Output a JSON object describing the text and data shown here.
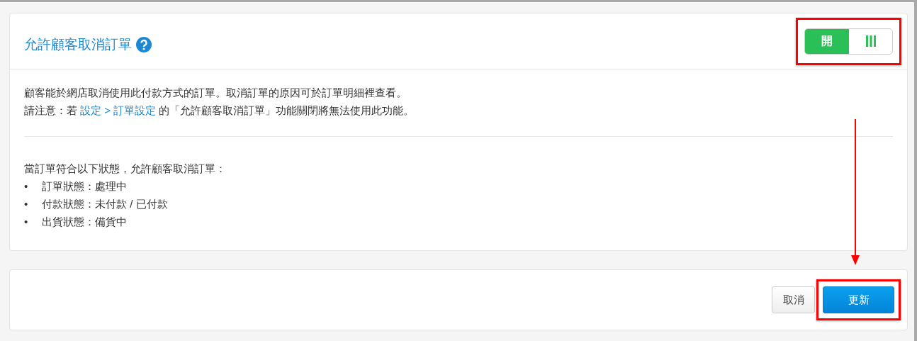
{
  "settings_card": {
    "title": "允許顧客取消訂單",
    "toggle": {
      "label": "開",
      "on": true,
      "highlighted": true
    },
    "description": {
      "line_1": "顧客能於網店取消使用此付款方式的訂單。取消訂單的原因可於訂單明細裡查看。",
      "line_2_before": "請注意：若",
      "line_2_link": "設定 > 訂單設定",
      "line_2_after": "的「允許顧客取消訂單」功能關閉將無法使用此功能。"
    },
    "conditions": {
      "intro": "當訂單符合以下狀態，允許顧客取消訂單：",
      "items": [
        {
          "bullet": "•",
          "text": "訂單狀態：處理中"
        },
        {
          "bullet": "•",
          "text": "付款狀態：未付款 / 已付款"
        },
        {
          "bullet": "•",
          "text": "出貨狀態：備貨中"
        }
      ]
    }
  },
  "annotation_arrow": true,
  "footer": {
    "cancel_button": "取消",
    "update_button": {
      "label": "更新",
      "highlighted": true
    }
  }
}
